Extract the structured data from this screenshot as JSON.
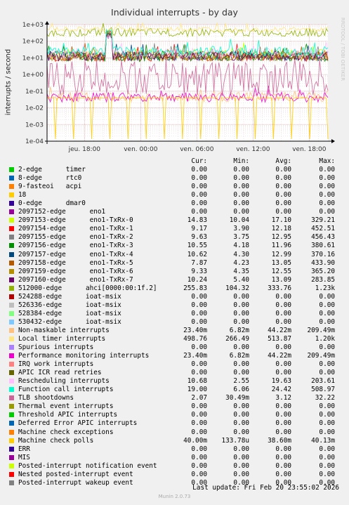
{
  "title": "Individual interrupts - by day",
  "ylabel": "interrupts / second",
  "side_text": "RRDTOOL / TOBI OETIKER",
  "headers": {
    "cur": "Cur:",
    "min": "Min:",
    "avg": "Avg:",
    "max": "Max:"
  },
  "last_update": "Last update: Fri Feb 20 23:55:02 2026",
  "footer": "Munin 2.0.73",
  "chart_data": {
    "type": "line",
    "yscale": "log",
    "ylim": [
      0.0001,
      1000
    ],
    "y_ticks": [
      "1e-04",
      "1e-03",
      "1e-02",
      "1e-01",
      "1e+00",
      "1e+01",
      "1e+02",
      "1e+03"
    ],
    "x_ticks": [
      "jeu. 18:00",
      "ven. 00:00",
      "ven. 06:00",
      "ven. 12:00",
      "ven. 18:00"
    ],
    "grid": true,
    "series": [
      {
        "name": "2-edge      timer",
        "color": "#00cc00",
        "cur": "0.00",
        "min": "0.00",
        "avg": "0.00",
        "max": "0.00"
      },
      {
        "name": "8-edge      rtc0",
        "color": "#0066b3",
        "cur": "0.00",
        "min": "0.00",
        "avg": "0.00",
        "max": "0.00"
      },
      {
        "name": "9-fasteoi   acpi",
        "color": "#ff8000",
        "cur": "0.00",
        "min": "0.00",
        "avg": "0.00",
        "max": "0.00"
      },
      {
        "name": "18",
        "color": "#ffcc00",
        "cur": "0.00",
        "min": "0.00",
        "avg": "0.00",
        "max": "0.00"
      },
      {
        "name": "0-edge      dmar0",
        "color": "#330099",
        "cur": "0.00",
        "min": "0.00",
        "avg": "0.00",
        "max": "0.00"
      },
      {
        "name": "2097152-edge      eno1",
        "color": "#990099",
        "cur": "0.00",
        "min": "0.00",
        "avg": "0.00",
        "max": "0.00"
      },
      {
        "name": "2097153-edge      eno1-TxRx-0",
        "color": "#ccff00",
        "cur": "14.83",
        "min": "10.04",
        "avg": "17.10",
        "max": "329.21"
      },
      {
        "name": "2097154-edge      eno1-TxRx-1",
        "color": "#ff0000",
        "cur": "9.17",
        "min": "3.90",
        "avg": "12.18",
        "max": "452.51"
      },
      {
        "name": "2097155-edge      eno1-TxRx-2",
        "color": "#808080",
        "cur": "9.63",
        "min": "3.75",
        "avg": "12.95",
        "max": "456.43"
      },
      {
        "name": "2097156-edge      eno1-TxRx-3",
        "color": "#008f00",
        "cur": "10.55",
        "min": "4.18",
        "avg": "11.96",
        "max": "380.61"
      },
      {
        "name": "2097157-edge      eno1-TxRx-4",
        "color": "#00487d",
        "cur": "10.62",
        "min": "4.30",
        "avg": "12.99",
        "max": "370.16"
      },
      {
        "name": "2097158-edge      eno1-TxRx-5",
        "color": "#b35a00",
        "cur": "7.87",
        "min": "4.23",
        "avg": "13.05",
        "max": "433.90"
      },
      {
        "name": "2097159-edge      eno1-TxRx-6",
        "color": "#b38f00",
        "cur": "9.33",
        "min": "4.35",
        "avg": "12.55",
        "max": "365.20"
      },
      {
        "name": "2097160-edge      eno1-TxRx-7",
        "color": "#6b006b",
        "cur": "10.24",
        "min": "5.40",
        "avg": "13.09",
        "max": "283.85"
      },
      {
        "name": "512000-edge      ahci[0000:00:1f.2]",
        "color": "#8fb300",
        "cur": "255.83",
        "min": "104.32",
        "avg": "333.76",
        "max": "1.23k"
      },
      {
        "name": "524288-edge      ioat-msix",
        "color": "#b30000",
        "cur": "0.00",
        "min": "0.00",
        "avg": "0.00",
        "max": "0.00"
      },
      {
        "name": "526336-edge      ioat-msix",
        "color": "#bebebe",
        "cur": "0.00",
        "min": "0.00",
        "avg": "0.00",
        "max": "0.00"
      },
      {
        "name": "528384-edge      ioat-msix",
        "color": "#80ff80",
        "cur": "0.00",
        "min": "0.00",
        "avg": "0.00",
        "max": "0.00"
      },
      {
        "name": "530432-edge      ioat-msix",
        "color": "#80c9ff",
        "cur": "0.00",
        "min": "0.00",
        "avg": "0.00",
        "max": "0.00"
      },
      {
        "name": "Non-maskable interrupts",
        "color": "#ffc080",
        "cur": "23.40m",
        "min": "6.82m",
        "avg": "44.22m",
        "max": "209.49m"
      },
      {
        "name": "Local timer interrupts",
        "color": "#ffe680",
        "cur": "498.76",
        "min": "266.49",
        "avg": "513.87",
        "max": "1.20k"
      },
      {
        "name": "Spurious interrupts",
        "color": "#aa80ff",
        "cur": "0.00",
        "min": "0.00",
        "avg": "0.00",
        "max": "0.00"
      },
      {
        "name": "Performance monitoring interrupts",
        "color": "#ee00cc",
        "cur": "23.40m",
        "min": "6.82m",
        "avg": "44.22m",
        "max": "209.49m"
      },
      {
        "name": "IRQ work interrupts",
        "color": "#ff8080",
        "cur": "0.00",
        "min": "0.00",
        "avg": "0.00",
        "max": "0.00"
      },
      {
        "name": "APIC ICR read retries",
        "color": "#666600",
        "cur": "0.00",
        "min": "0.00",
        "avg": "0.00",
        "max": "0.00"
      },
      {
        "name": "Rescheduling interrupts",
        "color": "#ffbfff",
        "cur": "10.68",
        "min": "2.55",
        "avg": "19.63",
        "max": "203.61"
      },
      {
        "name": "Function call interrupts",
        "color": "#00ffcc",
        "cur": "19.00",
        "min": "6.06",
        "avg": "24.42",
        "max": "508.97"
      },
      {
        "name": "TLB shootdowns",
        "color": "#cc6699",
        "cur": "2.07",
        "min": "30.49m",
        "avg": "3.12",
        "max": "32.22"
      },
      {
        "name": "Thermal event interrupts",
        "color": "#999900",
        "cur": "0.00",
        "min": "0.00",
        "avg": "0.00",
        "max": "0.00"
      },
      {
        "name": "Threshold APIC interrupts",
        "color": "#00cc00",
        "cur": "0.00",
        "min": "0.00",
        "avg": "0.00",
        "max": "0.00"
      },
      {
        "name": "Deferred Error APIC interrupts",
        "color": "#0066b3",
        "cur": "0.00",
        "min": "0.00",
        "avg": "0.00",
        "max": "0.00"
      },
      {
        "name": "Machine check exceptions",
        "color": "#ff8000",
        "cur": "0.00",
        "min": "0.00",
        "avg": "0.00",
        "max": "0.00"
      },
      {
        "name": "Machine check polls",
        "color": "#ffcc00",
        "cur": "40.00m",
        "min": "133.78u",
        "avg": "38.60m",
        "max": "40.13m"
      },
      {
        "name": "ERR",
        "color": "#330099",
        "cur": "0.00",
        "min": "0.00",
        "avg": "0.00",
        "max": "0.00"
      },
      {
        "name": "MIS",
        "color": "#990099",
        "cur": "0.00",
        "min": "0.00",
        "avg": "0.00",
        "max": "0.00"
      },
      {
        "name": "Posted-interrupt notification event",
        "color": "#ccff00",
        "cur": "0.00",
        "min": "0.00",
        "avg": "0.00",
        "max": "0.00"
      },
      {
        "name": "Nested posted-interrupt event",
        "color": "#ff0000",
        "cur": "0.00",
        "min": "0.00",
        "avg": "0.00",
        "max": "0.00"
      },
      {
        "name": "Posted-interrupt wakeup event",
        "color": "#808080",
        "cur": "0.00",
        "min": "0.00",
        "avg": "0.00",
        "max": "0.00"
      }
    ]
  }
}
